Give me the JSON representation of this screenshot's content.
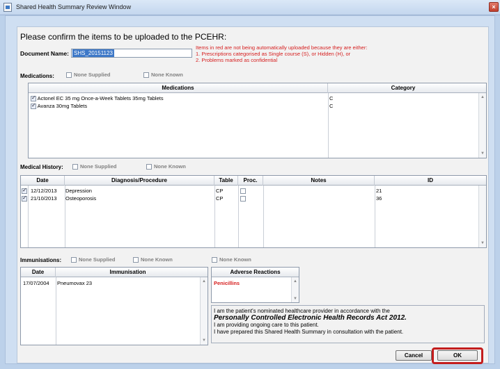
{
  "window": {
    "title": "Shared Health Summary Review Window",
    "close_label": "×"
  },
  "header": {
    "heading": "Please confirm the items to be uploaded to the PCEHR:",
    "document_name_label": "Document Name:",
    "document_name_value": "SHS_20151123",
    "red_note": [
      "Items in red are not being automatically uploaded because they are either:",
      "1. Prescriptions categorised as Single course (S), or Hidden (H), or",
      "2. Problems marked as confidential"
    ]
  },
  "medications": {
    "label": "Medications:",
    "none_supplied": "None Supplied",
    "none_known": "None Known",
    "columns": [
      "Medications",
      "Category"
    ],
    "rows": [
      {
        "name": "Actonel EC 35 mg Once-a-Week Tablets 35mg Tablets",
        "category": "C",
        "checked": true
      },
      {
        "name": "Avanza 30mg Tablets",
        "category": "C",
        "checked": true
      }
    ]
  },
  "medical_history": {
    "label": "Medical History:",
    "none_supplied": "None Supplied",
    "none_known": "None Known",
    "columns": [
      "Date",
      "Diagnosis/Procedure",
      "Table",
      "Proc.",
      "Notes",
      "ID"
    ],
    "rows": [
      {
        "date": "12/12/2013",
        "diagnosis": "Depression",
        "table": "CP",
        "proc": false,
        "notes": "",
        "id": "21",
        "checked": true
      },
      {
        "date": "21/10/2013",
        "diagnosis": "Osteoporosis",
        "table": "CP",
        "proc": false,
        "notes": "",
        "id": "36",
        "checked": true
      }
    ]
  },
  "immunisations": {
    "label": "Immunisations:",
    "none_supplied": "None Supplied",
    "none_known": "None Known",
    "none_known_2": "None Known",
    "columns": [
      "Date",
      "Immunisation"
    ],
    "rows": [
      {
        "date": "17/07/2004",
        "name": "Pneumovax 23"
      }
    ]
  },
  "adverse_reactions": {
    "header": "Adverse Reactions",
    "items": [
      "Penicillins"
    ]
  },
  "consent": {
    "line1": "I am the patient's nominated healthcare provider in accordance with the",
    "act": "Personally Controlled Electronic Health Records Act 2012.",
    "line2": "I am providing ongoing care to this patient.",
    "line3": "I have prepared this Shared Health Summary in consultation with the patient."
  },
  "buttons": {
    "cancel": "Cancel",
    "ok": "OK"
  },
  "colors": {
    "alert_red": "#d61e1e",
    "arrow_blue": "#3a6fb8",
    "selection_blue": "#3d78c8"
  },
  "icons": {
    "annotation_arrow": "arrow-left-icon",
    "scroll_up": "scroll-up-icon",
    "scroll_down": "scroll-down-icon"
  }
}
